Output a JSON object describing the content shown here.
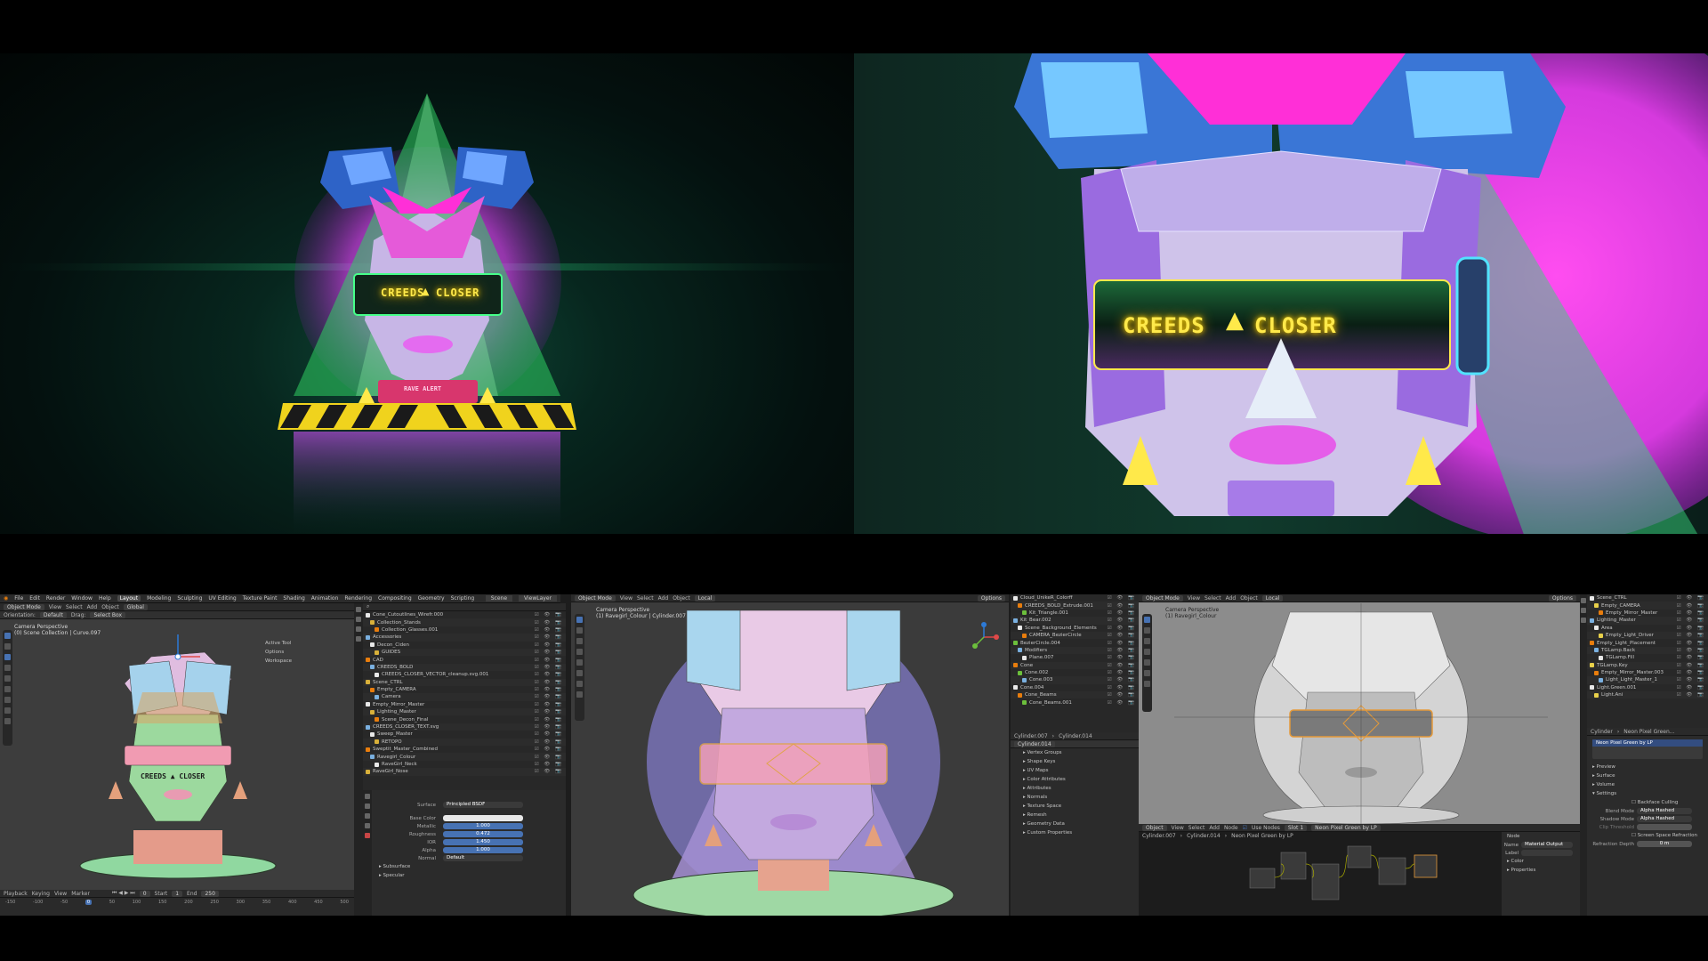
{
  "render_left": {
    "visor_text_left": "CREEDS",
    "visor_text_right": "CLOSER",
    "base_label": "RAVE ALERT"
  },
  "render_right": {
    "visor_text_left": "CREEDS",
    "visor_text_right": "CLOSER"
  },
  "blender": {
    "menu": [
      "File",
      "Edit",
      "Render",
      "Window",
      "Help"
    ],
    "workspaces": [
      "Layout",
      "Modeling",
      "Sculpting",
      "UV Editing",
      "Texture Paint",
      "Shading",
      "Animation",
      "Rendering",
      "Compositing",
      "Geometry",
      "Scripting"
    ],
    "active_workspace": "Layout",
    "scene": "Scene",
    "view_layer": "ViewLayer",
    "viewport1": {
      "mode": "Object Mode",
      "menus": [
        "View",
        "Select",
        "Add",
        "Object"
      ],
      "transform": "Global",
      "orientation": "Orientation:",
      "orientation_value": "Default",
      "drag": "Drag:",
      "drag_value": "Select Box",
      "label_line1": "Camera Perspective",
      "label_line2": "(0) Scene Collection | Curve.097",
      "visor_text": "CREEDS ▲ CLOSER",
      "panel": [
        "Active Tool",
        "Options",
        "Workspace"
      ]
    },
    "timeline": {
      "playback": "Playback",
      "keying": "Keying",
      "view": "View",
      "marker": "Marker",
      "current_frame": "0",
      "start_label": "Start",
      "start": "1",
      "end_label": "End",
      "end": "250",
      "ticks": [
        "-150",
        "-100",
        "-50",
        "0",
        "50",
        "100",
        "150",
        "200",
        "250",
        "300",
        "350",
        "400",
        "450",
        "500"
      ]
    },
    "outliner1": {
      "items": [
        "Cone_Cutoutlines_Wirefr.000",
        "Collection_Stands",
        "Collection_Glasses.001",
        "Accessories",
        "Decon_Ciden",
        "GUIDES",
        "CAD",
        "CREEDS_BOLD",
        "CREEDS_CLOSER_VECTOR_cleanup.svg.001",
        "Scene_CTRL",
        "Empty_CAMERA",
        "Camera",
        "Empty_Mirror_Master",
        "Lighting_Master",
        "Scene_Decon_Final",
        "CREEDS_CLOSER_TEXT.svg",
        "Sweep_Master",
        "RETOPO",
        "Sweptit_Master_Combined",
        "Ravegirl_Colour",
        "RaveGirl_Neck",
        "RaveGirl_Nose"
      ]
    },
    "properties1": {
      "surface_label": "Surface",
      "surface_value": "Principled BSDF",
      "rows": [
        {
          "key": "Base Color",
          "value": ""
        },
        {
          "key": "Metallic",
          "value": "1.000"
        },
        {
          "key": "Roughness",
          "value": "0.472"
        },
        {
          "key": "IOR",
          "value": "1.450"
        },
        {
          "key": "Alpha",
          "value": "1.000"
        },
        {
          "key": "Normal",
          "value": "Default"
        }
      ],
      "sections": [
        "Subsurface",
        "Specular"
      ]
    },
    "viewport2": {
      "mode": "Object Mode",
      "menus": [
        "View",
        "Select",
        "Add",
        "Object"
      ],
      "transform": "Local",
      "options": "Options",
      "label_line1": "Camera Perspective",
      "label_line2": "(1) Ravegirl_Colour | Cylinder.007"
    },
    "outliner2": {
      "items": [
        "Cloud_UnikeR_Colorff",
        "CREEDS_BOLD_Extrude.001",
        "Kit_Triangle.001",
        "Kit_Bear.002",
        "Scene_Background_Elements",
        "CAMERA_BezierCircle",
        "BezierCircle.004",
        "Modifiers",
        "Plane.007",
        "Cone",
        "Cone.002",
        "Cone.003",
        "Cone.004",
        "Cone_Beams",
        "Cone_Beams.001"
      ],
      "object_a": "Cylinder.007",
      "object_b": "Cylinder.014",
      "mesh_name": "Cylinder.014",
      "sections": [
        "Vertex Groups",
        "Shape Keys",
        "UV Maps",
        "Color Attributes",
        "Attributes",
        "Normals",
        "Texture Space",
        "Remesh",
        "Geometry Data",
        "Custom Properties"
      ]
    },
    "viewport3": {
      "mode": "Object Mode",
      "menus": [
        "View",
        "Select",
        "Add",
        "Object"
      ],
      "transform": "Local",
      "options": "Options",
      "label_line1": "Camera Perspective",
      "label_line2": "(1) Ravegirl_Colour"
    },
    "node_editor": {
      "header": [
        "Object",
        "View",
        "Select",
        "Add",
        "Node"
      ],
      "use_nodes": "Use Nodes",
      "slot": "Slot 1",
      "material": "Neon Pixel Green by LP",
      "breadcrumb": [
        "Cylinder.007",
        "Cylinder.014",
        "Neon Pixel Green by LP"
      ],
      "side_panel": {
        "title": "Node",
        "name_label": "Name",
        "name_value": "Material Output",
        "label_label": "Label",
        "color": "Color",
        "properties": "Properties"
      }
    },
    "outliner3": {
      "items": [
        "Scene_CTRL",
        "Empty_CAMERA",
        "Empty_Mirror_Master",
        "Lighting_Master",
        "Area",
        "Empty_Light_Driver",
        "Empty_Light_Placement",
        "TGLamp.Back",
        "TGLamp.Fill",
        "TGLamp.Key",
        "Empty_Mirror_Master.003",
        "Light_Light_Master_1",
        "Light.Green.001",
        "Light.Ani"
      ]
    },
    "material_props": {
      "object": "Cylinder",
      "material": "Neon Pixel Green...",
      "slot_selected": "Neon Pixel Green by LP",
      "sections": [
        "Preview",
        "Surface",
        "Volume",
        "Settings"
      ],
      "backface_culling": "Backface Culling",
      "blend_mode_label": "Blend Mode",
      "blend_mode": "Alpha Hashed",
      "shadow_mode_label": "Shadow Mode",
      "shadow_mode": "Alpha Hashed",
      "clip_threshold": "Clip Threshold",
      "screen_space": "Screen Space Refraction",
      "refraction_depth": "Refraction Depth",
      "refraction_value": "0 m"
    }
  }
}
